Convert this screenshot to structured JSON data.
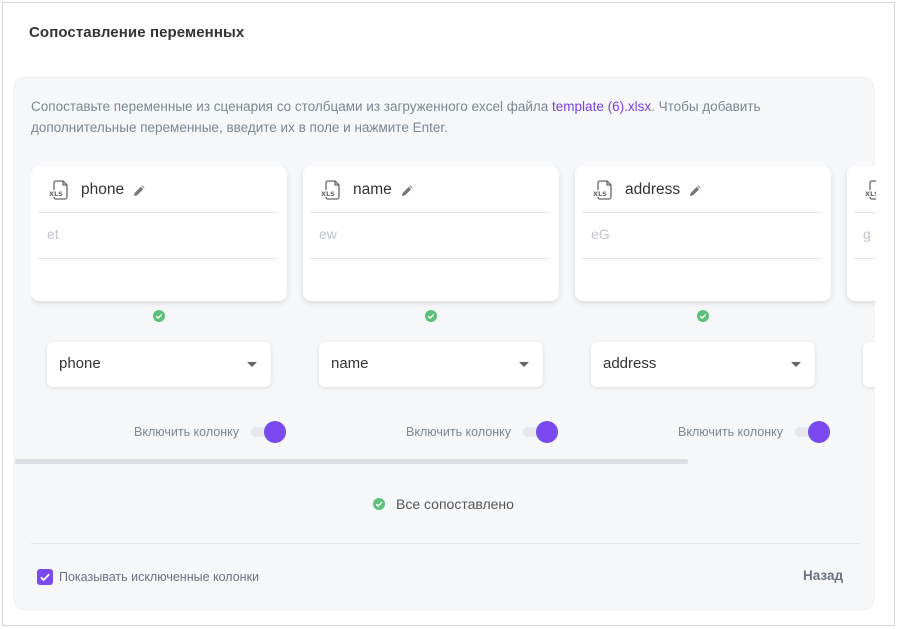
{
  "dialog": {
    "title": "Сопоставление переменных"
  },
  "description": {
    "before": "Сопоставьте переменные из сценария со столбцами из загруженного excel файла ",
    "file_link": "template (6).xlsx",
    "after": ". Чтобы добавить дополнительные переменные, введите их в поле и нажмите Enter."
  },
  "columns": [
    {
      "name": "phone",
      "sample": "et",
      "mapped": "phone",
      "toggle_label": "Включить колонку",
      "enabled": true
    },
    {
      "name": "name",
      "sample": "ew",
      "mapped": "name",
      "toggle_label": "Включить колонку",
      "enabled": true
    },
    {
      "name": "address",
      "sample": "eG",
      "mapped": "address",
      "toggle_label": "Включить колонку",
      "enabled": true
    },
    {
      "name": "",
      "sample": "g",
      "mapped": "",
      "toggle_label": "",
      "enabled": true
    }
  ],
  "icons": {
    "file": "xls-file-icon",
    "edit": "pencil-icon",
    "status": "check-circle-icon",
    "caret": "chevron-down-icon"
  },
  "status": {
    "text": "Все сопоставлено"
  },
  "footer": {
    "show_excluded_label": "Показывать исключенные колонки",
    "show_excluded_checked": true,
    "back_label": "Назад"
  },
  "colors": {
    "accent": "#7b49f0",
    "link": "#7b3fe4",
    "success": "#5cbf7c"
  }
}
